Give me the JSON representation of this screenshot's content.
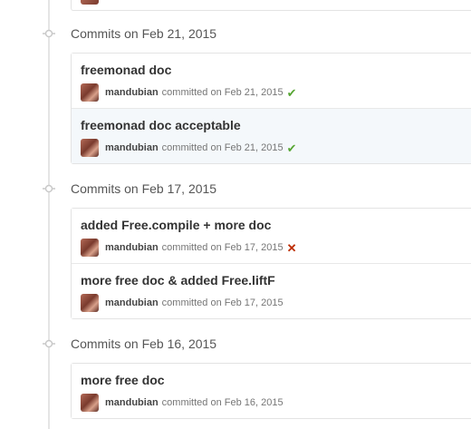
{
  "colors": {
    "success": "#55a532",
    "failure": "#bd2c00",
    "border": "#e3e3e3",
    "highlight_bg": "#f4f8fb"
  },
  "groups": [
    {
      "title": "Commits on Feb 21, 2015",
      "commits": [
        {
          "title": "freemonad doc",
          "author": "mandubian",
          "committed": "committed on Feb 21, 2015",
          "status_icon": "check-icon"
        },
        {
          "title": "freemonad doc acceptable",
          "author": "mandubian",
          "committed": "committed on Feb 21, 2015",
          "status_icon": "check-icon"
        }
      ]
    },
    {
      "title": "Commits on Feb 17, 2015",
      "commits": [
        {
          "title": "added Free.compile + more doc",
          "author": "mandubian",
          "committed": "committed on Feb 17, 2015",
          "status_icon": "x-icon"
        },
        {
          "title": "more free doc & added Free.liftF",
          "author": "mandubian",
          "committed": "committed on Feb 17, 2015"
        }
      ]
    },
    {
      "title": "Commits on Feb 16, 2015",
      "commits": [
        {
          "title": "more free doc",
          "author": "mandubian",
          "committed": "committed on Feb 16, 2015"
        }
      ]
    }
  ],
  "icons": {
    "success": "✔",
    "failure": "✕"
  }
}
